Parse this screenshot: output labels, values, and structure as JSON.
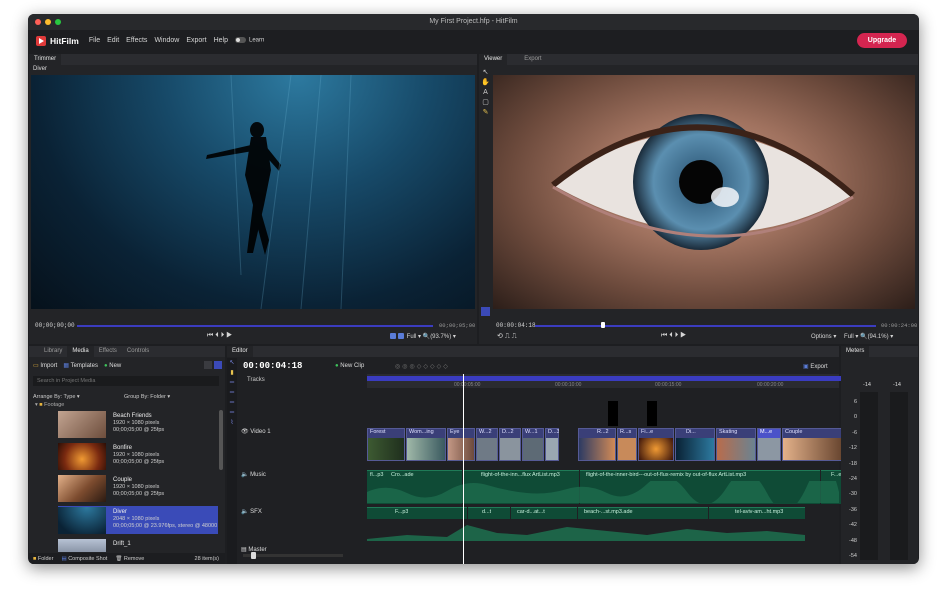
{
  "window": {
    "title": "My First Project.hfp - HitFilm"
  },
  "menu": {
    "logo": "HitFilm",
    "items": [
      "File",
      "Edit",
      "Effects",
      "Window",
      "Export",
      "Help"
    ],
    "learn": "Learn",
    "upgrade": "Upgrade"
  },
  "trimmer": {
    "tab": "Trimmer",
    "clip_name": "Diver",
    "timecode_start": "00;00;00;00",
    "timecode_end": "00;00;05;00",
    "quality": "Full",
    "zoom": "(93.7%)"
  },
  "viewer": {
    "tabs": [
      "Viewer",
      "Export"
    ],
    "timecode_start": "00:00:04:18",
    "timecode_end": "00:00:24:00",
    "options": "Options",
    "quality": "Full",
    "zoom": "(94.1%)"
  },
  "media": {
    "tabs": [
      "Library",
      "Media",
      "Effects",
      "Controls"
    ],
    "import": "Import",
    "templates": "Templates",
    "new": "New",
    "search_placeholder": "Search in Project Media",
    "arrange": "Arrange By: Type",
    "group": "Group By: Folder",
    "folder": "Footage",
    "items": [
      {
        "name": "Beach Friends",
        "size": "1920 × 1080 pixels",
        "duration": "00;00;05;00 @ 25fps"
      },
      {
        "name": "Bonfire",
        "size": "1920 × 1080 pixels",
        "duration": "00;00;05;00 @ 25fps"
      },
      {
        "name": "Couple",
        "size": "1920 × 1080 pixels",
        "duration": "00;00;05;00 @ 25fps"
      },
      {
        "name": "Diver",
        "size": "2048 × 1080 pixels",
        "duration": "00;00;05;00 @ 23.976fps, stereo @ 48000"
      },
      {
        "name": "Drift_1",
        "size": "",
        "duration": ""
      }
    ],
    "footer": {
      "folder": "Folder",
      "composite": "Composite Shot",
      "remove": "Remove",
      "count": "28 item(s)"
    }
  },
  "editor": {
    "tab": "Editor",
    "timecode": "00:00:04:18",
    "new_clip": "New Clip",
    "export": "Export",
    "tracks_label": "Tracks",
    "ruler": [
      "00:00:05:00",
      "00:00:10:00",
      "00:00:15:00",
      "00:00:20:00"
    ],
    "tracks": [
      {
        "name": "Video 1"
      },
      {
        "name": "Music"
      },
      {
        "name": "SFX"
      },
      {
        "name": "Master"
      }
    ],
    "video_clips": [
      "Forest",
      "Wom...ing",
      "Eye",
      "W...2",
      "D...2",
      "W...1",
      "D...3",
      "R...2",
      "R...s",
      "Fi...e",
      "Di...",
      "Skating",
      "M...e",
      "Couple"
    ],
    "music_clips": [
      "fl...p3",
      "Cro...ade",
      "flight-of-the-inn...flux ArtList.mp3",
      "flight-of-the-inner-bird---out-of-flux-remix by out-of-flux ArtList.mp3",
      "F...e"
    ],
    "sfx_clips": [
      "F...p3",
      "d...t",
      "car-d...at...t",
      "beach-...st.mp3.ade",
      "tel-aviv-am...ht.mp3"
    ]
  },
  "meters": {
    "tab": "Meters",
    "peaks": [
      "-14",
      "-14"
    ],
    "scale": [
      "6",
      "0",
      "-6",
      "-12",
      "-18",
      "-24",
      "-30",
      "-36",
      "-42",
      "-48",
      "-54"
    ]
  }
}
